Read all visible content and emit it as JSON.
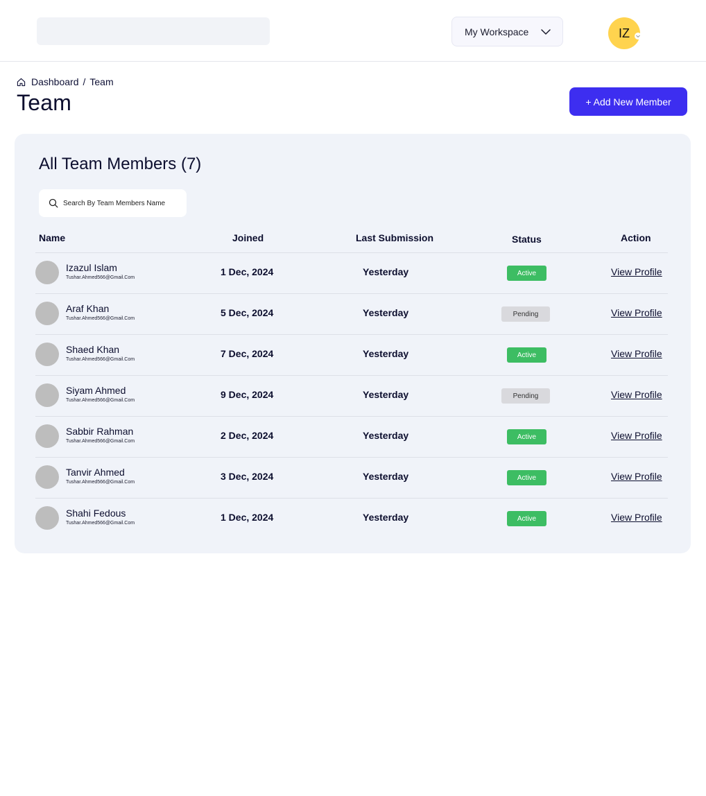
{
  "header": {
    "workspace_label": "My Workspace",
    "user_initials": "IZ"
  },
  "breadcrumb": {
    "items": [
      "Dashboard",
      "/",
      "Team"
    ]
  },
  "page": {
    "title": "Team",
    "add_button_label": "+ Add New Member"
  },
  "team": {
    "title": "All Team Members (7)",
    "search_placeholder": "Search By Team Members Name",
    "columns": [
      "Name",
      "Joined",
      "Last Submission",
      "Status",
      "Action"
    ],
    "members": [
      {
        "name": "Izazul Islam",
        "email": "Tushar.Ahmed566@Gmail.Com",
        "joined": "1 Dec, 2024",
        "last_submission": "Yesterday",
        "status": "Active",
        "action": "View Profile"
      },
      {
        "name": "Araf Khan",
        "email": "Tushar.Ahmed566@Gmail.Com",
        "joined": "5 Dec, 2024",
        "last_submission": "Yesterday",
        "status": "Pending",
        "action": "View Profile"
      },
      {
        "name": "Shaed Khan",
        "email": "Tushar.Ahmed566@Gmail.Com",
        "joined": "7 Dec, 2024",
        "last_submission": "Yesterday",
        "status": "Active",
        "action": "View Profile"
      },
      {
        "name": "Siyam Ahmed",
        "email": "Tushar.Ahmed566@Gmail.Com",
        "joined": "9 Dec, 2024",
        "last_submission": "Yesterday",
        "status": "Pending",
        "action": "View Profile"
      },
      {
        "name": "Sabbir Rahman",
        "email": "Tushar.Ahmed566@Gmail.Com",
        "joined": "2 Dec, 2024",
        "last_submission": "Yesterday",
        "status": "Active",
        "action": "View Profile"
      },
      {
        "name": "Tanvir Ahmed",
        "email": "Tushar.Ahmed566@Gmail.Com",
        "joined": "3 Dec, 2024",
        "last_submission": "Yesterday",
        "status": "Active",
        "action": "View Profile"
      },
      {
        "name": "Shahi Fedous",
        "email": "Tushar.Ahmed566@Gmail.Com",
        "joined": "1 Dec, 2024",
        "last_submission": "Yesterday",
        "status": "Active",
        "action": "View Profile"
      }
    ]
  },
  "colors": {
    "accent": "#3d2ef0",
    "active_badge": "#3dbd63",
    "pending_badge": "#d9d9dd",
    "avatar_yellow": "#ffd34e",
    "card_bg": "#f0f3f9"
  },
  "icons": [
    "home-icon",
    "chevron-down-icon",
    "search-icon"
  ]
}
